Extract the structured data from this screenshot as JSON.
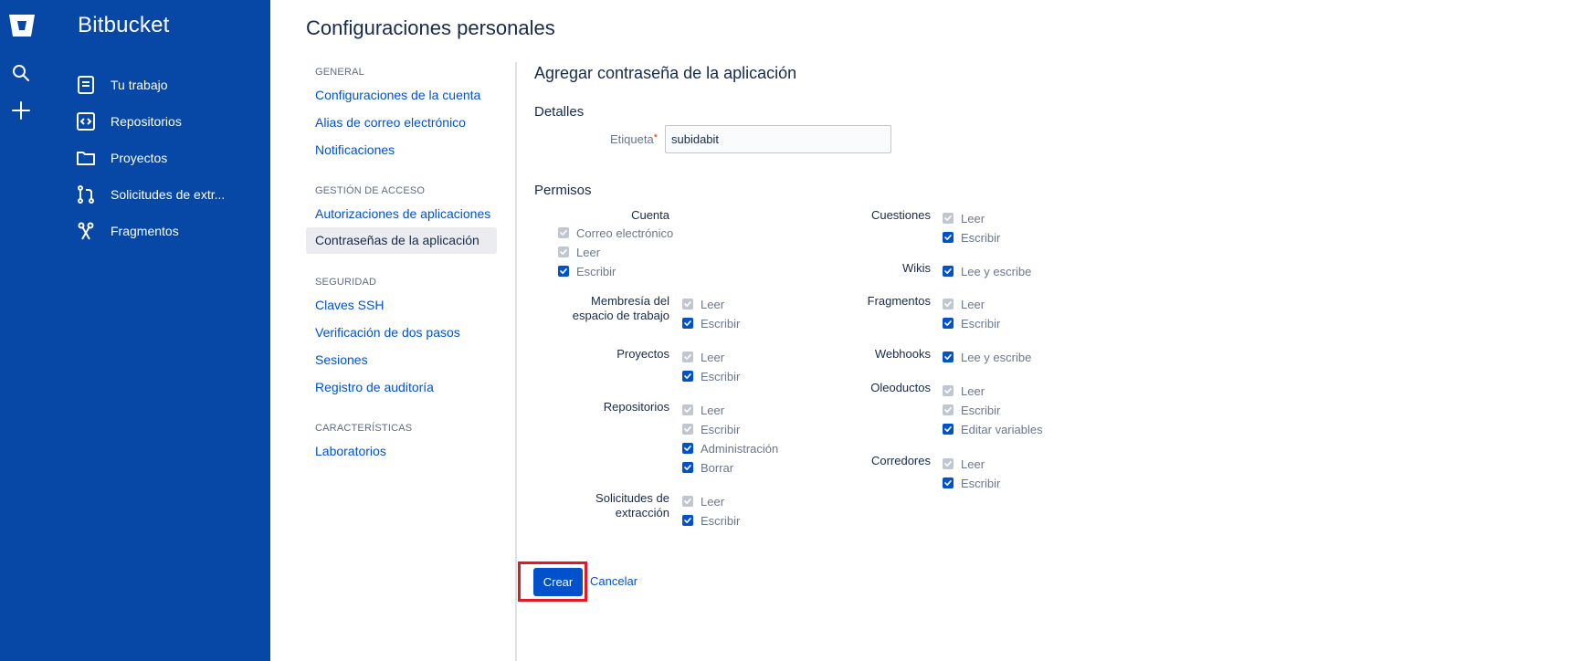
{
  "app": {
    "brand": "Bitbucket"
  },
  "nav": {
    "items": [
      {
        "label": "Tu trabajo",
        "icon": "document-icon"
      },
      {
        "label": "Repositorios",
        "icon": "code-icon"
      },
      {
        "label": "Proyectos",
        "icon": "folder-icon"
      },
      {
        "label": "Solicitudes de extr...",
        "icon": "pull-request-icon"
      },
      {
        "label": "Fragmentos",
        "icon": "scissors-icon"
      }
    ]
  },
  "page": {
    "title": "Configuraciones personales"
  },
  "settings_nav": {
    "general": {
      "heading": "GENERAL",
      "links": [
        "Configuraciones de la cuenta",
        "Alias de correo electrónico",
        "Notificaciones"
      ]
    },
    "access": {
      "heading": "GESTIÓN DE ACCESO",
      "links": [
        "Autorizaciones de aplicaciones"
      ],
      "active": "Contraseñas de la aplicación"
    },
    "security": {
      "heading": "SEGURIDAD",
      "links": [
        "Claves SSH",
        "Verificación de dos pasos",
        "Sesiones",
        "Registro de auditoría"
      ]
    },
    "features": {
      "heading": "CARACTERÍSTICAS",
      "links": [
        "Laboratorios"
      ]
    }
  },
  "form": {
    "title": "Agregar contraseña de la aplicación",
    "details_heading": "Detalles",
    "label_field": {
      "label": "Etiqueta",
      "required_mark": "*",
      "value": "subidabit"
    },
    "permissions_heading": "Permisos",
    "permissions": {
      "cuenta": {
        "label": "Cuenta",
        "options": [
          "Correo electrónico",
          "Leer",
          "Escribir"
        ],
        "checked": [
          true,
          true,
          true
        ],
        "disabled": [
          true,
          true,
          false
        ]
      },
      "membresia": {
        "label_line1": "Membresía del",
        "label_line2": "espacio de trabajo",
        "options": [
          "Leer",
          "Escribir"
        ],
        "checked": [
          true,
          true
        ],
        "disabled": [
          true,
          false
        ]
      },
      "proyectos": {
        "label": "Proyectos",
        "options": [
          "Leer",
          "Escribir"
        ],
        "checked": [
          true,
          true
        ],
        "disabled": [
          true,
          false
        ]
      },
      "repositorios": {
        "label": "Repositorios",
        "options": [
          "Leer",
          "Escribir",
          "Administración",
          "Borrar"
        ],
        "checked": [
          true,
          true,
          true,
          true
        ],
        "disabled": [
          true,
          true,
          false,
          false
        ]
      },
      "solicitudes": {
        "label_line1": "Solicitudes de",
        "label_line2": "extracción",
        "options": [
          "Leer",
          "Escribir"
        ],
        "checked": [
          true,
          true
        ],
        "disabled": [
          true,
          false
        ]
      },
      "cuestiones": {
        "label": "Cuestiones",
        "options": [
          "Leer",
          "Escribir"
        ],
        "checked": [
          true,
          true
        ],
        "disabled": [
          true,
          false
        ]
      },
      "wikis": {
        "label": "Wikis",
        "options": [
          "Lee y escribe"
        ],
        "checked": [
          true
        ],
        "disabled": [
          false
        ]
      },
      "fragmentos": {
        "label": "Fragmentos",
        "options": [
          "Leer",
          "Escribir"
        ],
        "checked": [
          true,
          true
        ],
        "disabled": [
          true,
          false
        ]
      },
      "webhooks": {
        "label": "Webhooks",
        "options": [
          "Lee y escribe"
        ],
        "checked": [
          true
        ],
        "disabled": [
          false
        ]
      },
      "oleoductos": {
        "label": "Oleoductos",
        "options": [
          "Leer",
          "Escribir",
          "Editar variables"
        ],
        "checked": [
          true,
          true,
          true
        ],
        "disabled": [
          true,
          true,
          false
        ]
      },
      "corredores": {
        "label": "Corredores",
        "options": [
          "Leer",
          "Escribir"
        ],
        "checked": [
          true,
          true
        ],
        "disabled": [
          true,
          false
        ]
      }
    },
    "create_label": "Crear",
    "cancel_label": "Cancelar"
  },
  "colors": {
    "rail": "#0747a6",
    "primary": "#0052cc",
    "highlight": "#e21a23"
  }
}
